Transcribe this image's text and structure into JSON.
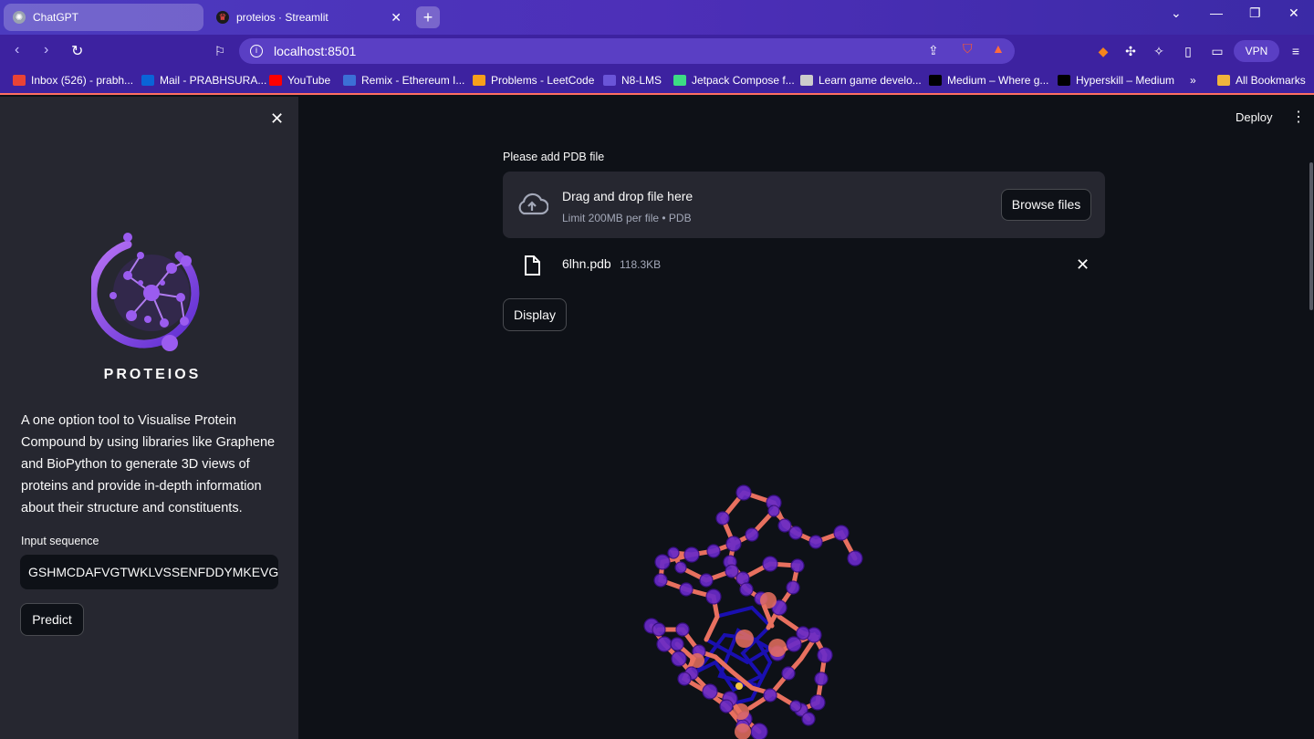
{
  "browser": {
    "tabs": [
      {
        "label": "ChatGPT",
        "active": false
      },
      {
        "label": "proteios · Streamlit",
        "active": true
      }
    ],
    "url": "localhost:8501",
    "vpn_label": "VPN",
    "bookmarks": [
      {
        "label": "Inbox (526) - prabh...",
        "icon_color": "#ea4335"
      },
      {
        "label": "Mail - PRABHSURA...",
        "icon_color": "#0a64d8"
      },
      {
        "label": "YouTube",
        "icon_color": "#ff0000"
      },
      {
        "label": "Remix - Ethereum I...",
        "icon_color": "#3c6fd6"
      },
      {
        "label": "Problems - LeetCode",
        "icon_color": "#f89f1b"
      },
      {
        "label": "N8-LMS",
        "icon_color": "#6a55d8"
      },
      {
        "label": "Jetpack Compose f...",
        "icon_color": "#3ddc84"
      },
      {
        "label": "Learn game develo...",
        "icon_color": "#cccccc"
      },
      {
        "label": "Medium – Where g...",
        "icon_color": "#000000"
      },
      {
        "label": "Hyperskill – Medium",
        "icon_color": "#000000"
      }
    ],
    "overflow_label": "»",
    "all_bookmarks_label": "All Bookmarks"
  },
  "sidebar": {
    "logo_text": "PROTEIOS",
    "description": "A one option tool to Visualise Protein Compound by using libraries like Graphene and BioPython to generate 3D views of proteins and provide in-depth information about their structure and constituents.",
    "input_label": "Input sequence",
    "input_value": "GSHMCDAFVGTWKLVSSENFDDYMKEVGVGF/",
    "predict_label": "Predict"
  },
  "main": {
    "deploy_label": "Deploy",
    "uploader_label": "Please add PDB file",
    "dropzone_title": "Drag and drop file here",
    "dropzone_subtitle": "Limit 200MB per file • PDB",
    "browse_label": "Browse files",
    "file_name": "6lhn.pdb",
    "file_size": "118.3KB",
    "display_label": "Display"
  },
  "colors": {
    "accent": "#8a4cf0",
    "bond": "#e8705f",
    "atom": "#6a2bc8",
    "backbone": "#1a0fb0"
  }
}
